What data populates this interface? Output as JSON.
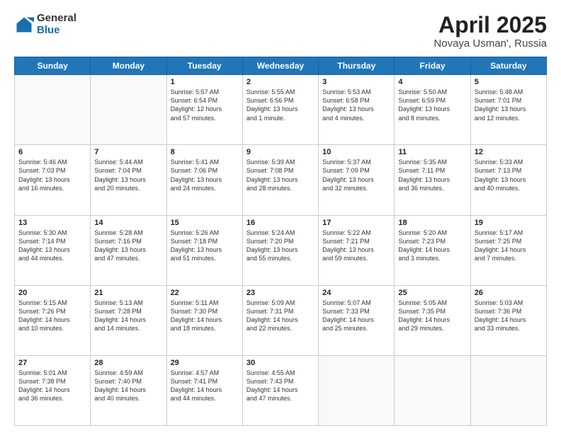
{
  "logo": {
    "general": "General",
    "blue": "Blue"
  },
  "title": "April 2025",
  "location": "Novaya Usman', Russia",
  "days_of_week": [
    "Sunday",
    "Monday",
    "Tuesday",
    "Wednesday",
    "Thursday",
    "Friday",
    "Saturday"
  ],
  "weeks": [
    [
      {
        "day": "",
        "text": ""
      },
      {
        "day": "",
        "text": ""
      },
      {
        "day": "1",
        "text": "Sunrise: 5:57 AM\nSunset: 6:54 PM\nDaylight: 12 hours\nand 57 minutes."
      },
      {
        "day": "2",
        "text": "Sunrise: 5:55 AM\nSunset: 6:56 PM\nDaylight: 13 hours\nand 1 minute."
      },
      {
        "day": "3",
        "text": "Sunrise: 5:53 AM\nSunset: 6:58 PM\nDaylight: 13 hours\nand 4 minutes."
      },
      {
        "day": "4",
        "text": "Sunrise: 5:50 AM\nSunset: 6:59 PM\nDaylight: 13 hours\nand 8 minutes."
      },
      {
        "day": "5",
        "text": "Sunrise: 5:48 AM\nSunset: 7:01 PM\nDaylight: 13 hours\nand 12 minutes."
      }
    ],
    [
      {
        "day": "6",
        "text": "Sunrise: 5:46 AM\nSunset: 7:03 PM\nDaylight: 13 hours\nand 16 minutes."
      },
      {
        "day": "7",
        "text": "Sunrise: 5:44 AM\nSunset: 7:04 PM\nDaylight: 13 hours\nand 20 minutes."
      },
      {
        "day": "8",
        "text": "Sunrise: 5:41 AM\nSunset: 7:06 PM\nDaylight: 13 hours\nand 24 minutes."
      },
      {
        "day": "9",
        "text": "Sunrise: 5:39 AM\nSunset: 7:08 PM\nDaylight: 13 hours\nand 28 minutes."
      },
      {
        "day": "10",
        "text": "Sunrise: 5:37 AM\nSunset: 7:09 PM\nDaylight: 13 hours\nand 32 minutes."
      },
      {
        "day": "11",
        "text": "Sunrise: 5:35 AM\nSunset: 7:11 PM\nDaylight: 13 hours\nand 36 minutes."
      },
      {
        "day": "12",
        "text": "Sunrise: 5:33 AM\nSunset: 7:13 PM\nDaylight: 13 hours\nand 40 minutes."
      }
    ],
    [
      {
        "day": "13",
        "text": "Sunrise: 5:30 AM\nSunset: 7:14 PM\nDaylight: 13 hours\nand 44 minutes."
      },
      {
        "day": "14",
        "text": "Sunrise: 5:28 AM\nSunset: 7:16 PM\nDaylight: 13 hours\nand 47 minutes."
      },
      {
        "day": "15",
        "text": "Sunrise: 5:26 AM\nSunset: 7:18 PM\nDaylight: 13 hours\nand 51 minutes."
      },
      {
        "day": "16",
        "text": "Sunrise: 5:24 AM\nSunset: 7:20 PM\nDaylight: 13 hours\nand 55 minutes."
      },
      {
        "day": "17",
        "text": "Sunrise: 5:22 AM\nSunset: 7:21 PM\nDaylight: 13 hours\nand 59 minutes."
      },
      {
        "day": "18",
        "text": "Sunrise: 5:20 AM\nSunset: 7:23 PM\nDaylight: 14 hours\nand 3 minutes."
      },
      {
        "day": "19",
        "text": "Sunrise: 5:17 AM\nSunset: 7:25 PM\nDaylight: 14 hours\nand 7 minutes."
      }
    ],
    [
      {
        "day": "20",
        "text": "Sunrise: 5:15 AM\nSunset: 7:26 PM\nDaylight: 14 hours\nand 10 minutes."
      },
      {
        "day": "21",
        "text": "Sunrise: 5:13 AM\nSunset: 7:28 PM\nDaylight: 14 hours\nand 14 minutes."
      },
      {
        "day": "22",
        "text": "Sunrise: 5:11 AM\nSunset: 7:30 PM\nDaylight: 14 hours\nand 18 minutes."
      },
      {
        "day": "23",
        "text": "Sunrise: 5:09 AM\nSunset: 7:31 PM\nDaylight: 14 hours\nand 22 minutes."
      },
      {
        "day": "24",
        "text": "Sunrise: 5:07 AM\nSunset: 7:33 PM\nDaylight: 14 hours\nand 25 minutes."
      },
      {
        "day": "25",
        "text": "Sunrise: 5:05 AM\nSunset: 7:35 PM\nDaylight: 14 hours\nand 29 minutes."
      },
      {
        "day": "26",
        "text": "Sunrise: 5:03 AM\nSunset: 7:36 PM\nDaylight: 14 hours\nand 33 minutes."
      }
    ],
    [
      {
        "day": "27",
        "text": "Sunrise: 5:01 AM\nSunset: 7:38 PM\nDaylight: 14 hours\nand 36 minutes."
      },
      {
        "day": "28",
        "text": "Sunrise: 4:59 AM\nSunset: 7:40 PM\nDaylight: 14 hours\nand 40 minutes."
      },
      {
        "day": "29",
        "text": "Sunrise: 4:57 AM\nSunset: 7:41 PM\nDaylight: 14 hours\nand 44 minutes."
      },
      {
        "day": "30",
        "text": "Sunrise: 4:55 AM\nSunset: 7:43 PM\nDaylight: 14 hours\nand 47 minutes."
      },
      {
        "day": "",
        "text": ""
      },
      {
        "day": "",
        "text": ""
      },
      {
        "day": "",
        "text": ""
      }
    ]
  ]
}
